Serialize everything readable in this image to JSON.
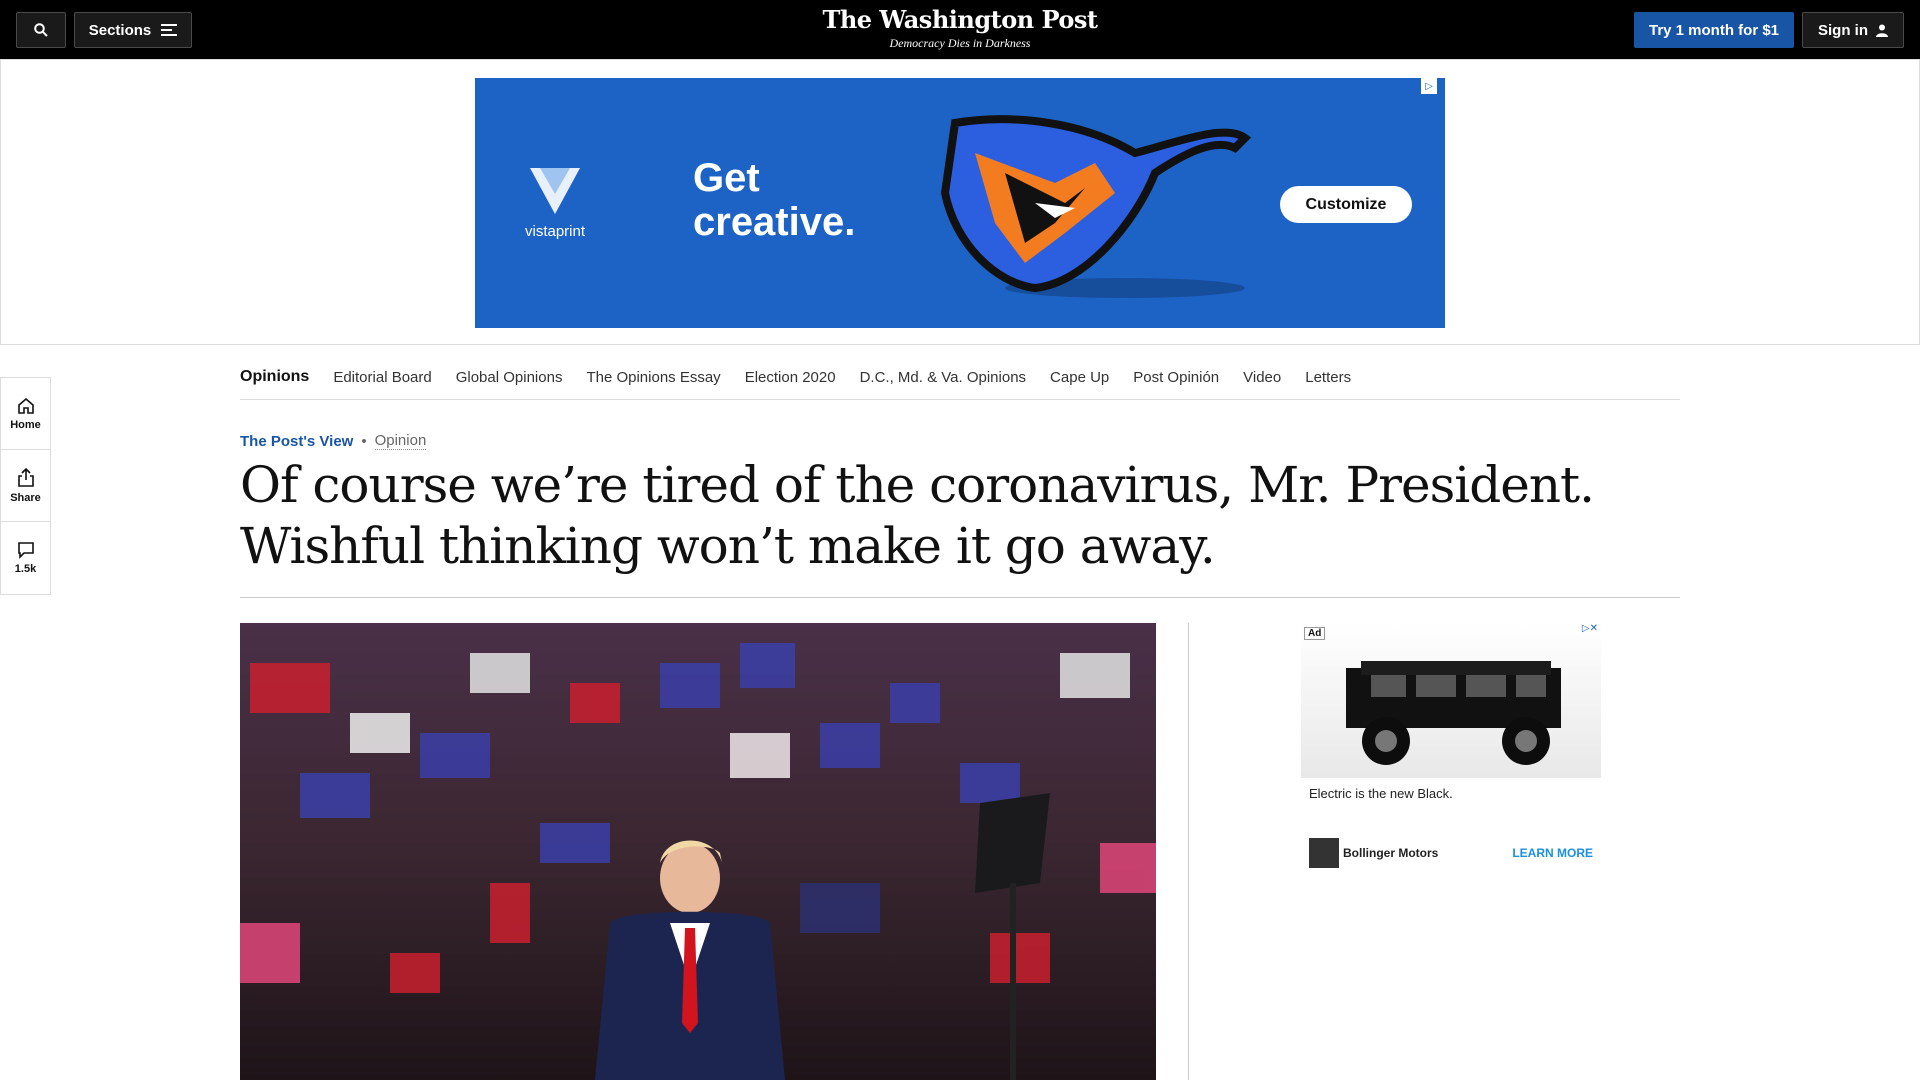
{
  "topbar": {
    "sections_label": "Sections",
    "logo": "The Washington Post",
    "tagline": "Democracy Dies in Darkness",
    "try_label": "Try 1 month for $1",
    "signin_label": "Sign in"
  },
  "banner_ad": {
    "brand": "vistaprint",
    "headline_line1": "Get",
    "headline_line2": "creative.",
    "cta": "Customize",
    "background_color": "#1d63c6"
  },
  "section_nav": {
    "items": [
      "Opinions",
      "Editorial Board",
      "Global Opinions",
      "The Opinions Essay",
      "Election 2020",
      "D.C., Md. & Va. Opinions",
      "Cape Up",
      "Post Opinión",
      "Video",
      "Letters"
    ]
  },
  "rail": {
    "home_label": "Home",
    "share_label": "Share",
    "comments_label": "1.5k"
  },
  "article": {
    "kicker": "The Post's View",
    "label": "Opinion",
    "headline": "Of course we’re tired of the coronavirus, Mr. President. Wishful thinking won’t make it go away."
  },
  "side_ad": {
    "ad_tag": "Ad",
    "caption": "Electric is the new Black.",
    "brand": "Bollinger Motors",
    "cta": "LEARN MORE"
  },
  "colors": {
    "accent": "#1955a5",
    "link": "#1d8fe0"
  }
}
